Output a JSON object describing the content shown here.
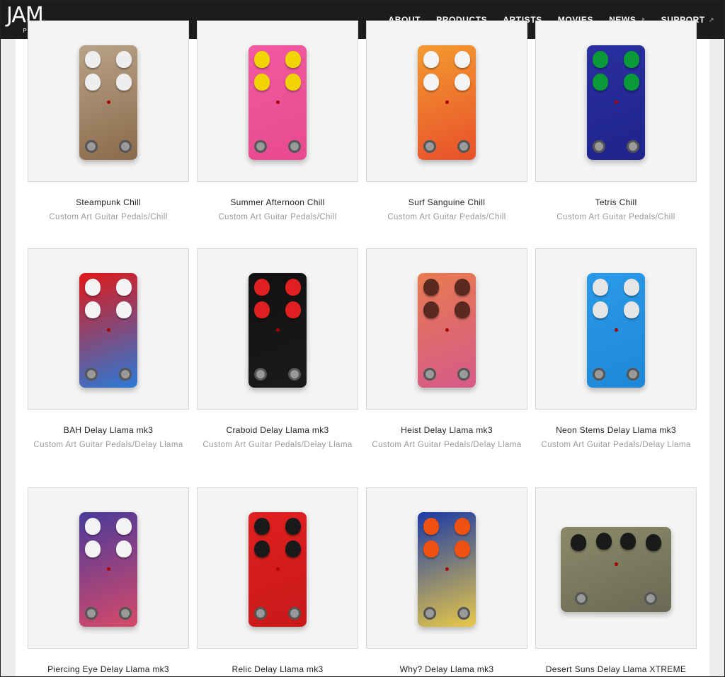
{
  "header": {
    "logo_main": "JAM",
    "logo_sub": "PEDALS",
    "nav": [
      {
        "label": "ABOUT",
        "external": false
      },
      {
        "label": "PRODUCTS",
        "external": false
      },
      {
        "label": "ARTISTS",
        "external": false
      },
      {
        "label": "MOVIES",
        "external": false
      },
      {
        "label": "NEWS",
        "external": true
      },
      {
        "label": "SUPPORT",
        "external": true
      }
    ]
  },
  "products": [
    {
      "title": "Steampunk Chill",
      "category": "Custom Art Guitar Pedals/Chill",
      "colors": [
        "#b9a288",
        "#8a6a4a"
      ],
      "knob": "#eee"
    },
    {
      "title": "Summer Afternoon Chill",
      "category": "Custom Art Guitar Pedals/Chill",
      "colors": [
        "#f05aa0",
        "#e84a90"
      ],
      "knob": "#f2d400"
    },
    {
      "title": "Surf Sanguine Chill",
      "category": "Custom Art Guitar Pedals/Chill",
      "colors": [
        "#f39a30",
        "#e8502a"
      ],
      "knob": "#f4f4f4"
    },
    {
      "title": "Tetris Chill",
      "category": "Custom Art Guitar Pedals/Chill",
      "colors": [
        "#2a2fa0",
        "#1e248a"
      ],
      "knob": "#0a9a3a"
    },
    {
      "title": "BAH Delay Llama mk3",
      "category": "Custom Art Guitar Pedals/Delay Llama",
      "colors": [
        "#e01818",
        "#2a7ad8"
      ],
      "knob": "#f4f4f4"
    },
    {
      "title": "Craboid Delay Llama mk3",
      "category": "Custom Art Guitar Pedals/Delay Llama",
      "colors": [
        "#111",
        "#1a1a1a"
      ],
      "knob": "#e02020"
    },
    {
      "title": "Heist Delay Llama mk3",
      "category": "Custom Art Guitar Pedals/Delay Llama",
      "colors": [
        "#e87a50",
        "#d65a8a"
      ],
      "knob": "#5a2a20"
    },
    {
      "title": "Neon Stems Delay Llama mk3",
      "category": "Custom Art Guitar Pedals/Delay Llama",
      "colors": [
        "#2a9ae8",
        "#1e88d8"
      ],
      "knob": "#e6e6e6"
    },
    {
      "title": "Piercing Eye Delay Llama mk3",
      "category": "",
      "colors": [
        "#4a3a9a",
        "#d64a6a"
      ],
      "knob": "#f4f4f4"
    },
    {
      "title": "Relic Delay Llama mk3",
      "category": "",
      "colors": [
        "#e02020",
        "#c81818"
      ],
      "knob": "#1a1a1a"
    },
    {
      "title": "Why? Delay Llama mk3",
      "category": "",
      "colors": [
        "#1a3aa8",
        "#e8c848"
      ],
      "knob": "#f05010"
    },
    {
      "title": "Desert Suns Delay Llama XTREME",
      "category": "",
      "colors": [
        "#8a8a6a",
        "#6a6a55"
      ],
      "knob": "#1a1a1a"
    }
  ]
}
